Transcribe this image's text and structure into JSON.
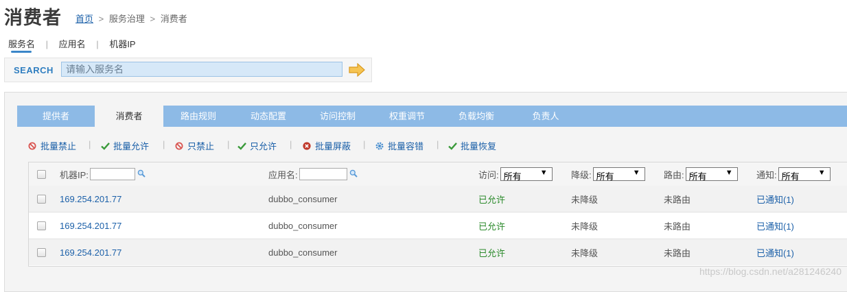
{
  "header": {
    "title": "消费者",
    "breadcrumb": {
      "home": "首页",
      "sep1": ">",
      "level1": "服务治理",
      "sep2": ">",
      "current": "消费者"
    }
  },
  "search": {
    "tabs": [
      {
        "label": "服务名",
        "active": true
      },
      {
        "label": "应用名",
        "active": false
      },
      {
        "label": "机器IP",
        "active": false
      }
    ],
    "tab_sep": "|",
    "label": "SEARCH",
    "placeholder": "请输入服务名",
    "value": ""
  },
  "nav_tabs": [
    {
      "label": "提供者",
      "active": false
    },
    {
      "label": "消费者",
      "active": true
    },
    {
      "label": "路由规则",
      "active": false
    },
    {
      "label": "动态配置",
      "active": false
    },
    {
      "label": "访问控制",
      "active": false
    },
    {
      "label": "权重调节",
      "active": false
    },
    {
      "label": "负载均衡",
      "active": false
    },
    {
      "label": "负责人",
      "active": false
    }
  ],
  "actions": {
    "sep": "|",
    "items": [
      {
        "label": "批量禁止",
        "icon": "forbid-icon"
      },
      {
        "label": "批量允许",
        "icon": "check-icon"
      },
      {
        "label": "只禁止",
        "icon": "forbid-icon"
      },
      {
        "label": "只允许",
        "icon": "check-icon"
      },
      {
        "label": "批量屏蔽",
        "icon": "block-icon"
      },
      {
        "label": "批量容错",
        "icon": "gear-icon"
      },
      {
        "label": "批量恢复",
        "icon": "check-icon"
      }
    ]
  },
  "table": {
    "headers": {
      "ip": "机器IP:",
      "app": "应用名:",
      "access": "访问:",
      "degrade": "降级:",
      "route": "路由:",
      "notify": "通知:"
    },
    "filters": {
      "access": "所有",
      "degrade": "所有",
      "route": "所有",
      "notify": "所有",
      "dropdown_glyph": "▼"
    },
    "rows": [
      {
        "ip": "169.254.201.77",
        "app": "dubbo_consumer",
        "access": "已允许",
        "degrade": "未降级",
        "route": "未路由",
        "notify": "已通知(1)"
      },
      {
        "ip": "169.254.201.77",
        "app": "dubbo_consumer",
        "access": "已允许",
        "degrade": "未降级",
        "route": "未路由",
        "notify": "已通知(1)"
      },
      {
        "ip": "169.254.201.77",
        "app": "dubbo_consumer",
        "access": "已允许",
        "degrade": "未降级",
        "route": "未路由",
        "notify": "已通知(1)"
      }
    ]
  },
  "watermark": "https://blog.csdn.net/a281246240",
  "colors": {
    "accent": "#2f7ec0",
    "nav_bar": "#8dbae6",
    "allowed": "#2b8a2b",
    "forbid": "#d9534f"
  }
}
